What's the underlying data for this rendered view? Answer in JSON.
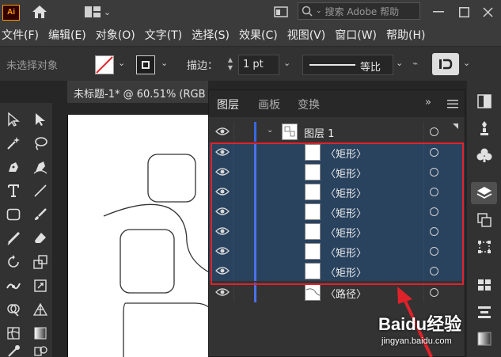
{
  "app": {
    "logo_text": "Ai",
    "search_placeholder": "搜索 Adobe 帮助"
  },
  "menubar": {
    "items": [
      "文件(F)",
      "编辑(E)",
      "对象(O)",
      "文字(T)",
      "选择(S)",
      "效果(C)",
      "视图(V)",
      "窗口(W)",
      "帮助(H)"
    ]
  },
  "control_bar": {
    "selection_status": "未选择对象",
    "stroke_label": "描边：",
    "stroke_weight": "1 pt",
    "stroke_style": "等比"
  },
  "document": {
    "tab_title": "未标题-1* @ 60.51% (RGB"
  },
  "layers_panel": {
    "tabs": [
      {
        "label": "图层",
        "active": true
      },
      {
        "label": "画板",
        "active": false
      },
      {
        "label": "变换",
        "active": false
      }
    ],
    "rows": [
      {
        "label": "图层 1",
        "selected": false
      },
      {
        "label": "〈矩形〉",
        "selected": true
      },
      {
        "label": "〈矩形〉",
        "selected": true
      },
      {
        "label": "〈矩形〉",
        "selected": true
      },
      {
        "label": "〈矩形〉",
        "selected": true
      },
      {
        "label": "〈矩形〉",
        "selected": true
      },
      {
        "label": "〈矩形〉",
        "selected": true
      },
      {
        "label": "〈矩形〉",
        "selected": true
      },
      {
        "label": "〈路径〉",
        "selected": false
      }
    ]
  },
  "annotation": {
    "highlight_color": "#e0222b",
    "arrow_color": "#e0222b"
  },
  "watermark": {
    "brand": "Baidu经验",
    "url": "jingyan.baidu.com"
  },
  "colors": {
    "accent_layer": "#4a72e8",
    "selection": "#29425e",
    "logo": "#ff9a00"
  }
}
